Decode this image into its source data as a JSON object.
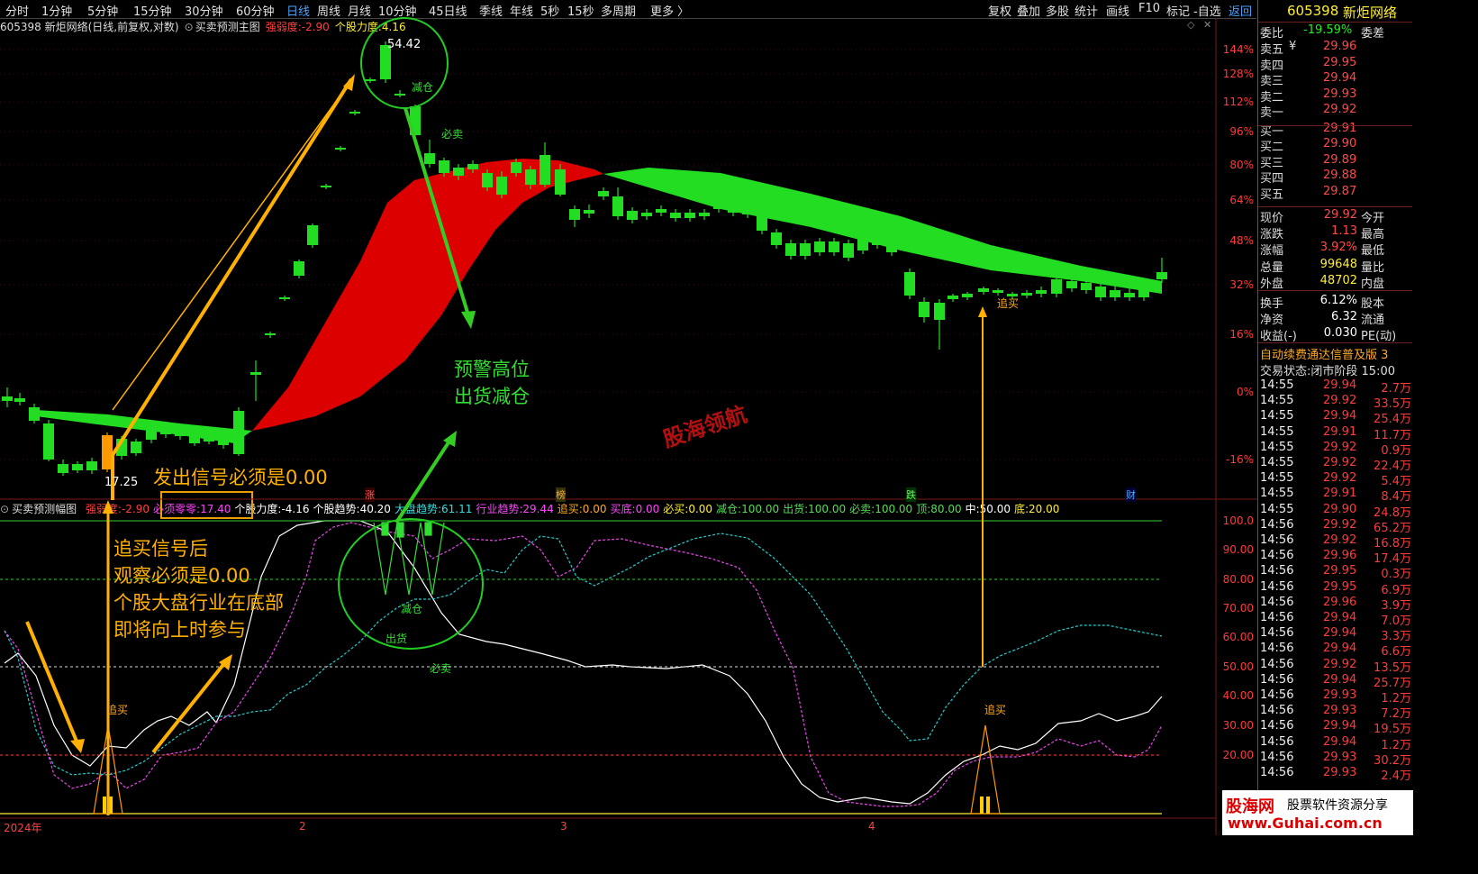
{
  "toolbar": {
    "timeframes": [
      "分时",
      "1分钟",
      "5分钟",
      "15分钟",
      "30分钟",
      "60分钟",
      "日线",
      "周线",
      "月线",
      "10分钟",
      "45日线",
      "季线",
      "年线",
      "5秒",
      "15秒",
      "多周期",
      "更多 〉"
    ],
    "active_index": 6,
    "right_tools": [
      "复权",
      "叠加",
      "多股",
      "统计",
      "画线",
      "F10",
      "标记",
      "-自选"
    ],
    "back": "返回"
  },
  "main_header": {
    "stock": "605398 新炬网络(日线,前复权,对数)",
    "indicator": "买卖预测主图",
    "strength_label": "强弱度:",
    "strength_value": "-2.90",
    "force_label": "个股力度:",
    "force_value": "4.16"
  },
  "sub_header": {
    "name": "买卖预测幅图",
    "items": [
      {
        "label": "强弱度:",
        "value": "-2.90",
        "color": "#ff4040"
      },
      {
        "label": "必须零零:",
        "value": "17.40",
        "color": "#ff44ff"
      },
      {
        "label": "个股力度:",
        "value": "-4.16",
        "color": "#ffffff"
      },
      {
        "label": "个股趋势:",
        "value": "40.20",
        "color": "#ffffff"
      },
      {
        "label": "大盘趋势:",
        "value": "61.11",
        "color": "#33e0e0"
      },
      {
        "label": "行业趋势:",
        "value": "29.44",
        "color": "#ff44ff"
      },
      {
        "label": "追买:",
        "value": "0.00",
        "color": "#ffaa22"
      },
      {
        "label": "买底:",
        "value": "0.00",
        "color": "#ff44ff"
      },
      {
        "label": "必买:",
        "value": "0.00",
        "color": "#ffee33"
      },
      {
        "label": "减仓:",
        "value": "100.00",
        "color": "#55dd55"
      },
      {
        "label": "出货:",
        "value": "100.00",
        "color": "#55dd55"
      },
      {
        "label": "必卖:",
        "value": "100.00",
        "color": "#55dd55"
      },
      {
        "label": "顶:",
        "value": "80.00",
        "color": "#55dd55"
      },
      {
        "label": "中:",
        "value": "50.00",
        "color": "#ffffff"
      },
      {
        "label": "底:",
        "value": "20.00",
        "color": "#ffee33"
      }
    ]
  },
  "main_axis": [
    "144%",
    "128%",
    "112%",
    "96%",
    "80%",
    "64%",
    "48%",
    "32%",
    "16%",
    "0%",
    "-16%"
  ],
  "sub_axis": [
    "100.0",
    "90.00",
    "80.00",
    "70.00",
    "60.00",
    "50.00",
    "40.00",
    "30.00",
    "20.00"
  ],
  "date_labels": [
    "2024年",
    "2",
    "3",
    "4"
  ],
  "event_markers": [
    "涨",
    "榜",
    "跌",
    "财"
  ],
  "chart_labels": {
    "high_price": "54.42",
    "low_price": "17.25",
    "reduce": "减仓",
    "must_sell": "必卖",
    "chase_buy": "追买",
    "sell_out": "出货"
  },
  "annotations": {
    "warn_top_1": "预警高位",
    "warn_top_2": "出货减仓",
    "signal_zero": "发出信号必须是0.00",
    "note_1": "追买信号后",
    "note_2": "观察必须是0.00",
    "note_3": "个股大盘行业在底部",
    "note_4": "即将向上时参与",
    "watermark": "股海领航"
  },
  "quote": {
    "code": "605398",
    "name": "新炬网络",
    "weibi_label": "委比",
    "weibi_value": "-19.59%",
    "weicha_label": "委差",
    "yen": "¥",
    "book": [
      {
        "label": "卖五",
        "price": "29.96"
      },
      {
        "label": "卖四",
        "price": "29.95"
      },
      {
        "label": "卖三",
        "price": "29.94"
      },
      {
        "label": "卖二",
        "price": "29.93"
      },
      {
        "label": "卖一",
        "price": "29.92"
      },
      {
        "label": "买一",
        "price": "29.91"
      },
      {
        "label": "买二",
        "price": "29.90"
      },
      {
        "label": "买三",
        "price": "29.89"
      },
      {
        "label": "买四",
        "price": "29.88"
      },
      {
        "label": "买五",
        "price": "29.87"
      }
    ],
    "stats": [
      {
        "l": "现价",
        "v": "29.92",
        "r": "今开"
      },
      {
        "l": "涨跌",
        "v": "1.13",
        "r": "最高"
      },
      {
        "l": "涨幅",
        "v": "3.92%",
        "r": "最低"
      },
      {
        "l": "总量",
        "v": "99648",
        "r": "量比"
      },
      {
        "l": "外盘",
        "v": "48702",
        "r": "内盘"
      },
      {
        "l": "换手",
        "v": "6.12%",
        "r": "股本"
      },
      {
        "l": "净资",
        "v": "6.32",
        "r": "流通"
      },
      {
        "l": "收益(-)",
        "v": "0.030",
        "r": "PE(动)"
      }
    ],
    "marquee": "自动续费通达信普及版  3",
    "status_label": "交易状态:",
    "status_value": "闭市阶段  15:00",
    "trades": [
      {
        "t": "14:55",
        "p": "29.94",
        "v": "2.7万"
      },
      {
        "t": "14:55",
        "p": "29.92",
        "v": "33.5万"
      },
      {
        "t": "14:55",
        "p": "29.94",
        "v": "25.4万"
      },
      {
        "t": "14:55",
        "p": "29.91",
        "v": "11.7万"
      },
      {
        "t": "14:55",
        "p": "29.92",
        "v": "0.9万"
      },
      {
        "t": "14:55",
        "p": "29.92",
        "v": "22.4万"
      },
      {
        "t": "14:55",
        "p": "29.92",
        "v": "5.4万"
      },
      {
        "t": "14:55",
        "p": "29.91",
        "v": "8.4万"
      },
      {
        "t": "14:55",
        "p": "29.90",
        "v": "24.8万"
      },
      {
        "t": "14:56",
        "p": "29.92",
        "v": "65.2万"
      },
      {
        "t": "14:56",
        "p": "29.92",
        "v": "16.8万"
      },
      {
        "t": "14:56",
        "p": "29.96",
        "v": "17.4万"
      },
      {
        "t": "14:56",
        "p": "29.95",
        "v": "0.3万"
      },
      {
        "t": "14:56",
        "p": "29.95",
        "v": "6.9万"
      },
      {
        "t": "14:56",
        "p": "29.96",
        "v": "3.9万"
      },
      {
        "t": "14:56",
        "p": "29.94",
        "v": "7.0万"
      },
      {
        "t": "14:56",
        "p": "29.94",
        "v": "3.3万"
      },
      {
        "t": "14:56",
        "p": "29.94",
        "v": "6.6万"
      },
      {
        "t": "14:56",
        "p": "29.92",
        "v": "13.5万"
      },
      {
        "t": "14:56",
        "p": "29.94",
        "v": "25.7万"
      },
      {
        "t": "14:56",
        "p": "29.93",
        "v": "1.2万"
      },
      {
        "t": "14:56",
        "p": "29.93",
        "v": "7.2万"
      },
      {
        "t": "14:56",
        "p": "29.94",
        "v": "19.5万"
      },
      {
        "t": "14:56",
        "p": "29.94",
        "v": "1.2万"
      },
      {
        "t": "14:56",
        "p": "29.93",
        "v": "30.2万"
      },
      {
        "t": "14:56",
        "p": "29.93",
        "v": "2.4万"
      }
    ]
  },
  "logo": {
    "brand": "股海网",
    "slogan": "股票软件资源分享",
    "url": "www.Guhai.com.cn"
  },
  "colors": {
    "up": "#ff2020",
    "down": "#22dd22",
    "accent": "#ffb000",
    "blue": "#4aa3ff"
  }
}
